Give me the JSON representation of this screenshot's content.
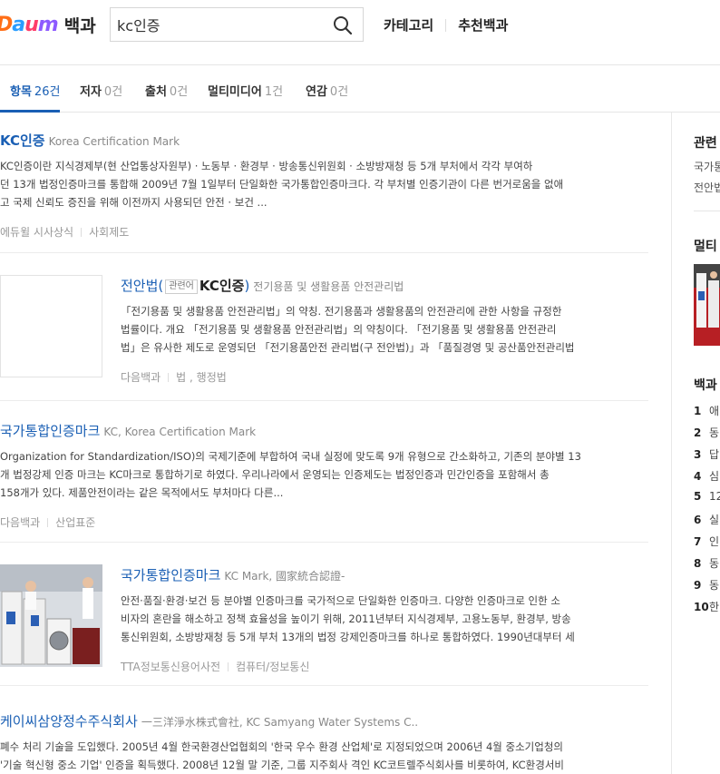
{
  "header": {
    "logo_letters": [
      "D",
      "a",
      "u",
      "m"
    ],
    "logo_text": "백과",
    "search_value": "kc인증",
    "nav": [
      "카테고리",
      "추천백과"
    ]
  },
  "tabs": [
    {
      "label": "항목",
      "count": "26건"
    },
    {
      "label": "저자",
      "count": "0건"
    },
    {
      "label": "출처",
      "count": "0건"
    },
    {
      "label": "멀티미디어",
      "count": "1건"
    },
    {
      "label": "연감",
      "count": "0건"
    }
  ],
  "results": [
    {
      "title": "KC인증",
      "subtitle": "Korea Certification Mark",
      "desc": [
        "KC인증이란 지식경제부(현 산업통상자원부) · 노동부 · 환경부 · 방송통신위원회 · 소방방재청 등 5개 부처에서 각각 부여하",
        "던 13개 법정인증마크를 통합해 2009년 7월 1일부터 단일화한 국가통합인증마크다. 각 부처별 인증기관이 다른 번거로움을 없애",
        "고 국제 신뢰도 증진을 위해 이전까지 사용되던 안전 · 보건 ..."
      ],
      "source": "에듀윌 시사상식",
      "category": "사회제도"
    },
    {
      "title": "전안법",
      "tag": "관련어",
      "tag_kw": "KC인증",
      "subtitle": "전기용품 및 생활용품 안전관리법",
      "desc": [
        "「전기용품 및 생활용품 안전관리법」의 약칭. 전기용품과 생활용품의 안전관리에 관한 사항을 규정한",
        "법률이다. 개요 「전기용품 및 생활용품 안전관리법」의 약칭이다. 「전기용품 및 생활용품 안전관리",
        "법」은 유사한 제도로 운영되던 「전기용품안전 관리법(구 전안법)」과 「품질경영 및 공산품안전관리법"
      ],
      "source": "다음백과",
      "category": "법 , 행정법"
    },
    {
      "title": "국가통합인증마크",
      "subtitle": "KC, Korea Certification Mark",
      "desc": [
        "Organization for Standardization/ISO)의 국제기준에 부합하여 국내 실정에 맞도록 9개 유형으로 간소화하고, 기존의 분야별 13",
        "개 법정강제 인증 마크는 KC마크로 통합하기로 하였다. 우리나라에서 운영되는 인증제도는 법정인증과 민간인증을 포함해서 총",
        "158개가 있다. 제품안전이라는 같은 목적에서도 부처마다 다른..."
      ],
      "source": "다음백과",
      "category": "산업표준"
    },
    {
      "title": "국가통합인증마크",
      "subtitle": "KC Mark, 國家統合認證-",
      "desc": [
        "안전·품질·환경·보건 등 분야별 인증마크를 국가적으로 단일화한 인증마크. 다양한 인증마크로 인한 소",
        "비자의 혼란을 해소하고 정책 효율성을 높이기 위해, 2011년부터 지식경제부, 고용노동부, 환경부, 방송",
        "통신위원회, 소방방재청 등 5개 부처 13개의 법정 강제인증마크를 하나로 통합하였다. 1990년대부터 세"
      ],
      "source": "TTA정보통신용어사전",
      "category": "컴퓨터/정보통신"
    },
    {
      "title": "케이씨삼양정수주식회사",
      "subtitle": "一三洋淨水株式會社, KC Samyang Water Systems C..",
      "desc": [
        "폐수 처리 기술을 도입했다. 2005년 4월 한국환경산업협회의 '한국 우수 환경 산업체'로 지정되었으며 2006년 4월 중소기업청의",
        "'기술 혁신형 중소 기업' 인증을 획득했다. 2008년 12월 말 기준, 그룹 지주회사 격인 KC코트렐주식회사를 비롯하여, KC환경서비"
      ]
    }
  ],
  "sidebar": {
    "related_title": "관련",
    "related_items": [
      "국가통",
      "전안법"
    ],
    "multimedia_title": "멀티",
    "ranking_title": "백과",
    "ranking": [
      {
        "n": "1",
        "t": "애"
      },
      {
        "n": "2",
        "t": "동"
      },
      {
        "n": "3",
        "t": "답"
      },
      {
        "n": "4",
        "t": "심"
      },
      {
        "n": "5",
        "t": "12"
      },
      {
        "n": "6",
        "t": "실"
      },
      {
        "n": "7",
        "t": "인"
      },
      {
        "n": "8",
        "t": "동"
      },
      {
        "n": "9",
        "t": "동"
      },
      {
        "n": "10",
        "t": "한"
      }
    ]
  }
}
